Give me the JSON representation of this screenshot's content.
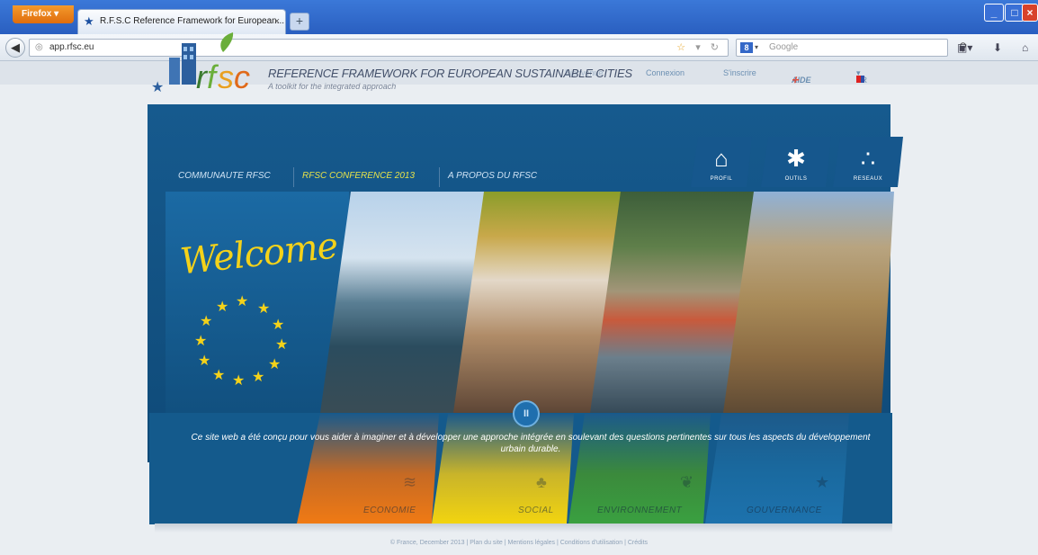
{
  "browser": {
    "firefox_label": "Firefox",
    "tab_title": "R.F.S.C Reference Framework for European...",
    "url": "app.rfsc.eu",
    "search_placeholder": "Google",
    "search_engine_icon": "google-icon"
  },
  "topbar": {
    "bienvenue": "Bienvenue",
    "connexion": "Connexion",
    "inscrire": "S'inscrire",
    "aide": "AIDE",
    "lang": "FR"
  },
  "site": {
    "logo_text": "rfsc",
    "title": "REFERENCE FRAMEWORK FOR EUROPEAN SUSTAINABLE CITIES",
    "subtitle": "A toolkit for the integrated approach"
  },
  "menu": {
    "item1": "COMMUNAUTE RFSC",
    "item2": "RFSC CONFERENCE 2013",
    "item3": "A PROPOS DU RFSC"
  },
  "side_tabs": [
    {
      "label": "PROFIL",
      "icon": "house-icon"
    },
    {
      "label": "OUTILS",
      "icon": "gear-icon"
    },
    {
      "label": "RESEAUX",
      "icon": "network-icon"
    }
  ],
  "welcome": "Welcome !",
  "intro": "Ce site web a été conçu pour vous aider à imaginer et à développer une approche intégrée en soulevant des questions pertinentes sur tous les aspects du développement urbain durable.",
  "categories": [
    {
      "label": "ECONOMIE",
      "icon": "coins-icon",
      "color": "#f07a14"
    },
    {
      "label": "SOCIAL",
      "icon": "people-icon",
      "color": "#f2d410"
    },
    {
      "label": "ENVIRONNEMENT",
      "icon": "leaf-icon",
      "color": "#3aa040"
    },
    {
      "label": "GOUVERNANCE",
      "icon": "star-icon",
      "color": "#1d72ad"
    }
  ],
  "footer": "© France, December 2013 | Plan du site | Mentions légales | Conditions d'utilisation | Crédits",
  "colors": {
    "brand_blue": "#165a8e",
    "welcome_yellow": "#f4d21a",
    "titlebar_blue": "#2a5fc0"
  }
}
